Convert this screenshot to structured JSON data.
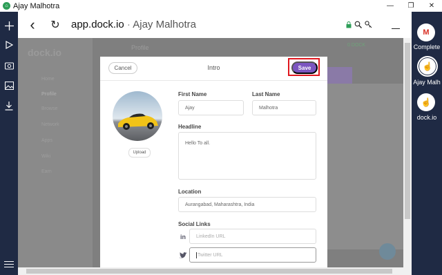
{
  "window": {
    "title": "Ajay Malhotra",
    "minimize": "—",
    "restore": "❐",
    "close": "✕"
  },
  "browser": {
    "domain": "app.dock.io",
    "separator": " · ",
    "page_user": "Ajay Malhotra",
    "back_icon": "‹",
    "refresh_icon": "↻"
  },
  "right_rail": {
    "bots": [
      {
        "label": "Complete",
        "icon": "M"
      },
      {
        "label": "Ajay Malh",
        "icon": "☝"
      },
      {
        "label": "dock.io",
        "icon": "☝"
      }
    ]
  },
  "background_page": {
    "logo": "dock.io",
    "header_title": "Profile",
    "balance": "0 DOCK",
    "nav_items": [
      "Home",
      "Profile",
      "Browse",
      "Network",
      "Apps",
      "Wiki",
      "Earn"
    ]
  },
  "modal": {
    "title": "Intro",
    "cancel_label": "Cancel",
    "save_label": "Save",
    "upload_label": "Upload",
    "first_name": {
      "label": "First Name",
      "value": "Ajay"
    },
    "last_name": {
      "label": "Last Name",
      "value": "Malhotra"
    },
    "headline": {
      "label": "Headline",
      "value": "Hello To all."
    },
    "location": {
      "label": "Location",
      "value": "Aurangabad, Maharashtra, India"
    },
    "social": {
      "label": "Social Links",
      "linkedin_placeholder": "LinkedIn URL",
      "twitter_placeholder": "Twitter URL"
    }
  },
  "colors": {
    "rail": "#1f2a44",
    "accent": "#7b56c0",
    "highlight": "#e0171e",
    "status_green": "#2e9e58"
  }
}
